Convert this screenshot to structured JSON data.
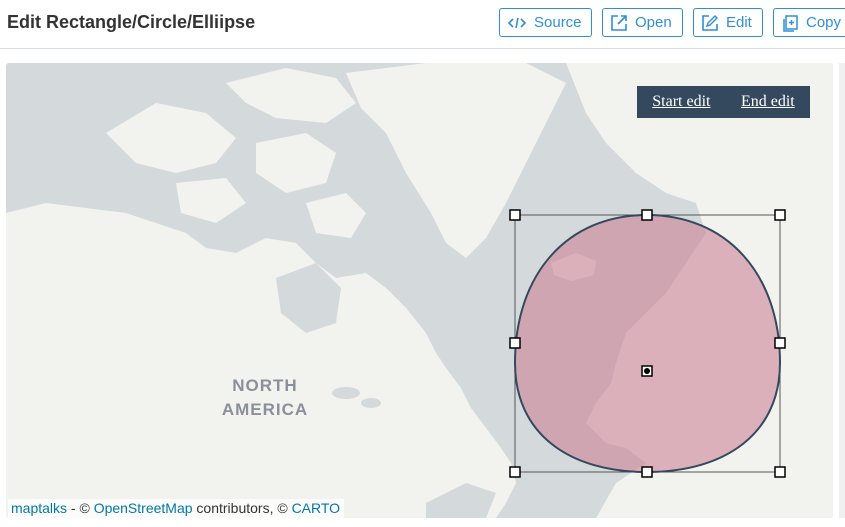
{
  "header": {
    "title": "Edit Rectangle/Circle/Elliipse",
    "buttons": [
      {
        "label": "Source",
        "icon": "code-icon"
      },
      {
        "label": "Open",
        "icon": "external-link-icon"
      },
      {
        "label": "Edit",
        "icon": "edit-icon"
      },
      {
        "label": "Copy",
        "icon": "copy-icon"
      }
    ]
  },
  "map": {
    "continent_label_line1": "NORTH",
    "continent_label_line2": "AMERICA",
    "edit_bar": {
      "start_label": "Start edit",
      "end_label": "End edit"
    },
    "attribution": {
      "link1": "maptalks",
      "sep1": " - © ",
      "link2": "OpenStreetMap",
      "sep2": " contributors, © ",
      "link3": "CARTO"
    },
    "colors": {
      "land": "#f2f2ef",
      "water": "#d4dadc",
      "ellipse_fill": "#c97a8e",
      "ellipse_stroke": "#34495e"
    }
  }
}
